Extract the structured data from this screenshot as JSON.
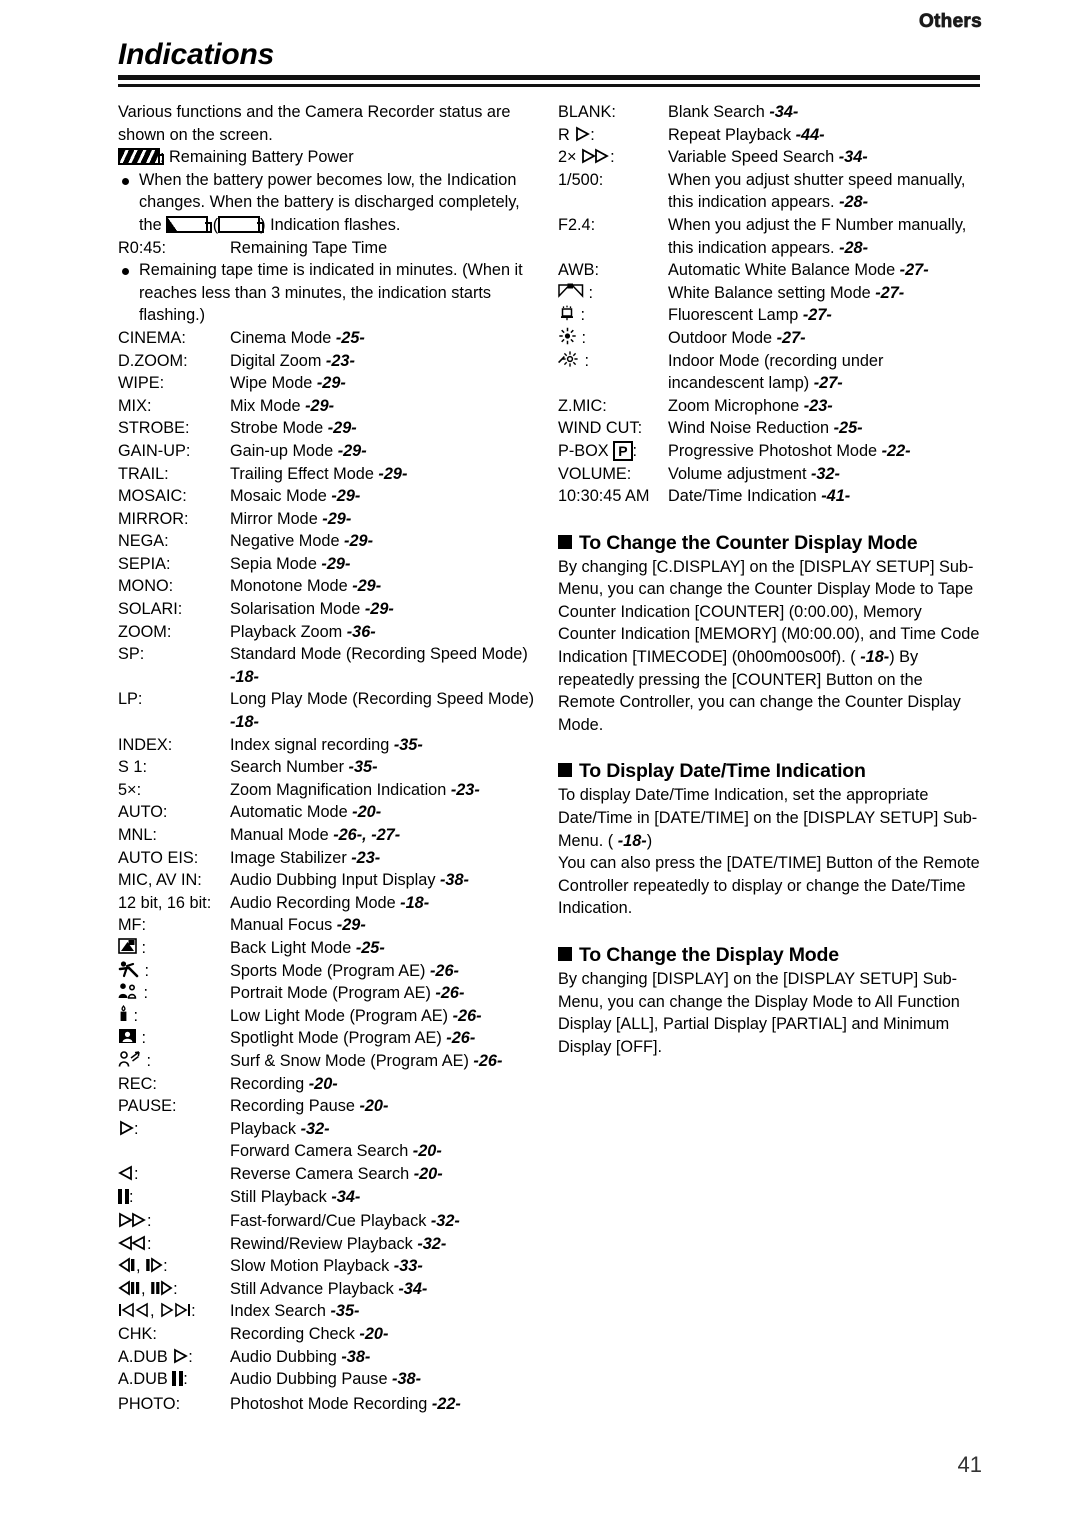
{
  "header": {
    "section_tab": "Others",
    "title": "Indications"
  },
  "page_number": "41",
  "left_column": {
    "intro": "Various functions and the Camera Recorder status are shown on the screen.",
    "battery_line_suffix": ": Remaining Battery Power",
    "battery_bullet_a": "When the battery power becomes low, the Indication changes. When the battery is discharged completely, the ",
    "battery_bullet_b": " (",
    "battery_bullet_c": ") Indication flashes.",
    "tape_label": "R0:45:",
    "tape_text": "Remaining Tape Time",
    "tape_bullet": "Remaining tape time is indicated in minutes. (When it reaches less than 3 minutes, the indication starts flashing.)",
    "items": [
      {
        "label": "CINEMA:",
        "desc": "Cinema Mode",
        "page": "-25-"
      },
      {
        "label": "D.ZOOM:",
        "desc": "Digital Zoom",
        "page": "-23-"
      },
      {
        "label": "WIPE:",
        "desc": "Wipe Mode",
        "page": "-29-"
      },
      {
        "label": "MIX:",
        "desc": "Mix Mode",
        "page": "-29-"
      },
      {
        "label": "STROBE:",
        "desc": "Strobe Mode",
        "page": "-29-"
      },
      {
        "label": "GAIN-UP:",
        "desc": "Gain-up Mode",
        "page": "-29-"
      },
      {
        "label": "TRAIL:",
        "desc": "Trailing Effect Mode",
        "page": "-29-"
      },
      {
        "label": "MOSAIC:",
        "desc": "Mosaic Mode",
        "page": "-29-"
      },
      {
        "label": "MIRROR:",
        "desc": "Mirror Mode",
        "page": "-29-"
      },
      {
        "label": "NEGA:",
        "desc": "Negative Mode",
        "page": "-29-"
      },
      {
        "label": "SEPIA:",
        "desc": "Sepia Mode",
        "page": "-29-"
      },
      {
        "label": "MONO:",
        "desc": "Monotone Mode",
        "page": "-29-"
      },
      {
        "label": "SOLARI:",
        "desc": "Solarisation Mode",
        "page": "-29-"
      },
      {
        "label": "ZOOM:",
        "desc": "Playback Zoom",
        "page": "-36-"
      },
      {
        "label": "SP:",
        "desc": "Standard Mode (Recording Speed Mode)",
        "page": "-18-"
      },
      {
        "label": "LP:",
        "desc": "Long Play Mode (Recording Speed Mode)",
        "page": "-18-"
      },
      {
        "label": "INDEX:",
        "desc": "Index signal recording",
        "page": "-35-"
      },
      {
        "label": "S 1:",
        "desc": "Search Number",
        "page": "-35-"
      },
      {
        "label": "5×:",
        "desc": "Zoom Magnification Indication",
        "page": "-23-"
      },
      {
        "label": "AUTO:",
        "desc": "Automatic Mode",
        "page": "-20-"
      },
      {
        "label": "MNL:",
        "desc": "Manual Mode",
        "page": "-26-, -27-"
      },
      {
        "label": "AUTO EIS:",
        "desc": "Image Stabilizer",
        "page": "-23-"
      },
      {
        "label": "MIC, AV IN:",
        "desc": "Audio Dubbing Input Display",
        "page": "-38-"
      },
      {
        "label": "12 bit, 16 bit:",
        "desc": "Audio Recording Mode",
        "page": "-18-"
      },
      {
        "label": "MF:",
        "desc": "Manual Focus",
        "page": "-29-"
      }
    ],
    "icon_items": [
      {
        "icon": "back-light-icon",
        "desc": "Back Light Mode",
        "page": "-25-"
      },
      {
        "icon": "sports-mode-icon",
        "desc": "Sports Mode (Program AE)",
        "page": "-26-"
      },
      {
        "icon": "portrait-mode-icon",
        "desc": "Portrait Mode (Program AE)",
        "page": "-26-"
      },
      {
        "icon": "low-light-icon",
        "desc": "Low Light Mode (Program AE)",
        "page": "-26-"
      },
      {
        "icon": "spotlight-icon",
        "desc": "Spotlight Mode (Program AE)",
        "page": "-26-"
      },
      {
        "icon": "surf-snow-icon",
        "desc": "Surf & Snow Mode (Program AE)",
        "page": "-26-"
      }
    ],
    "transport_items": [
      {
        "label": "REC:",
        "icon": "",
        "desc": "Recording",
        "page": "-20-"
      },
      {
        "label": "PAUSE:",
        "icon": "",
        "desc": "Recording Pause",
        "page": "-20-"
      },
      {
        "label": "",
        "icon": "play-icon",
        "desc": "Playback",
        "page": "-32-"
      },
      {
        "label": "",
        "icon": "",
        "desc": "Forward Camera Search",
        "page": "-20-"
      },
      {
        "label": "",
        "icon": "reverse-play-icon",
        "desc": "Reverse Camera Search",
        "page": "-20-"
      },
      {
        "label": "",
        "icon": "pause-icon",
        "desc": "Still Playback",
        "page": "-34-"
      },
      {
        "label": "",
        "icon": "fast-forward-icon",
        "desc": "Fast-forward/Cue Playback",
        "page": "-32-"
      },
      {
        "label": "",
        "icon": "rewind-icon",
        "desc": "Rewind/Review Playback",
        "page": "-32-"
      },
      {
        "label": "",
        "icon": "slow-motion-icon",
        "desc": "Slow Motion Playback",
        "page": "-33-"
      },
      {
        "label": "",
        "icon": "still-advance-icon",
        "desc": "Still Advance Playback",
        "page": "-34-"
      },
      {
        "label": "",
        "icon": "index-search-icon",
        "desc": "Index Search",
        "page": "-35-"
      },
      {
        "label": "CHK:",
        "icon": "",
        "desc": "Recording Check",
        "page": "-20-"
      },
      {
        "label": "A.DUB",
        "icon": "play-icon",
        "desc": "Audio Dubbing",
        "page": "-38-"
      },
      {
        "label": "A.DUB",
        "icon": "pause-icon",
        "desc": "Audio Dubbing Pause",
        "page": "-38-"
      },
      {
        "label": "PHOTO:",
        "icon": "",
        "desc": "Photoshot Mode Recording",
        "page": "-22-"
      }
    ]
  },
  "right_column": {
    "items": [
      {
        "label": "BLANK:",
        "desc": "Blank Search",
        "page": "-34-"
      },
      {
        "label": "R",
        "icon": "play-icon",
        "desc": "Repeat Playback",
        "page": "-44-"
      },
      {
        "label": "2×",
        "icon": "fast-forward-icon",
        "desc": "Variable Speed Search",
        "page": "-34-"
      },
      {
        "label": "1/500:",
        "desc": "When you adjust shutter speed manually, this indication appears.",
        "page": "-28-"
      },
      {
        "label": "F2.4:",
        "desc": "When you adjust the F Number manually, this indication appears.",
        "page": "-28-"
      },
      {
        "label": "AWB:",
        "desc": "Automatic White Balance Mode",
        "page": "-27-"
      }
    ],
    "icon_items": [
      {
        "icon": "white-balance-icon",
        "desc": "White Balance setting Mode",
        "page": "-27-"
      },
      {
        "icon": "fluorescent-icon",
        "desc": "Fluorescent Lamp",
        "page": "-27-"
      },
      {
        "icon": "outdoor-sun-icon",
        "desc": "Outdoor Mode",
        "page": "-27-"
      },
      {
        "icon": "indoor-lamp-icon",
        "desc": "Indoor Mode (recording under incandescent lamp)",
        "page": "-27-"
      }
    ],
    "items_after": [
      {
        "label": "Z.MIC:",
        "desc": "Zoom Microphone",
        "page": "-23-"
      },
      {
        "label": "WIND CUT:",
        "desc": "Wind Noise Reduction",
        "page": "-25-"
      },
      {
        "label": "P-BOX",
        "icon": "progressive-p-icon",
        "desc": "Progressive Photoshot Mode",
        "page": "-22-"
      },
      {
        "label": "VOLUME:",
        "desc": "Volume adjustment",
        "page": "-32-"
      },
      {
        "label": "10:30:45 AM",
        "desc": "Date/Time Indication",
        "page": "-41-"
      }
    ],
    "sections": [
      {
        "heading": "To Change the Counter Display Mode",
        "body_1": "By changing [C.DISPLAY] on the [DISPLAY SETUP] Sub-Menu, you can change the Counter Display Mode to Tape Counter Indication [COUNTER] (0:00.00), Memory Counter Indication [MEMORY] (M0:00.00), and Time Code Indication [TIMECODE] (0h00m00s00f). (",
        "body_page": "-18-",
        "body_2": ") By repeatedly pressing the [COUNTER] Button on the Remote Controller, you can change the Counter Display Mode."
      },
      {
        "heading": "To Display Date/Time Indication",
        "body_1": "To display Date/Time Indication, set the appropriate Date/Time in [DATE/TIME] on the [DISPLAY SETUP] Sub-Menu. (",
        "body_page": "-18-",
        "body_2": ")"
      },
      {
        "heading": "",
        "body_1": "You can also press the [DATE/TIME] Button of the Remote Controller repeatedly to display or change the Date/Time Indication.",
        "body_page": "",
        "body_2": ""
      },
      {
        "heading": "To Change the Display Mode",
        "body_1": "By changing [DISPLAY] on the [DISPLAY SETUP] Sub-Menu, you can change the Display Mode to All Function Display [ALL], Partial Display [PARTIAL] and Minimum Display [OFF].",
        "body_page": "",
        "body_2": ""
      }
    ]
  }
}
